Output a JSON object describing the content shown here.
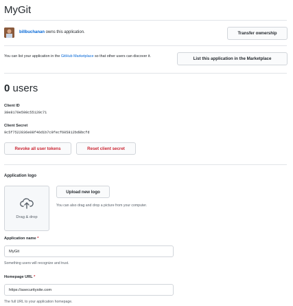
{
  "app": {
    "title": "MyGit"
  },
  "ownership": {
    "owner": "billbuchanan",
    "owns_text": " owns this application.",
    "transfer_label": "Transfer ownership"
  },
  "marketplace": {
    "text_before": "You can list your application in the ",
    "link_text": "GitHub Marketplace",
    "text_after": " so that other users can discover it.",
    "list_label": "List this application in the Marketplace"
  },
  "stats": {
    "user_count": "0",
    "user_word": "users"
  },
  "client": {
    "id_label": "Client ID",
    "id_value": "38e8170e598c55120c71",
    "secret_label": "Client Secret",
    "secret_value": "9c5f7522836e08f46d1b7c9fecf605812bd8bcfd"
  },
  "tokens": {
    "revoke_label": "Revoke all user tokens",
    "reset_label": "Reset client secret"
  },
  "logo": {
    "section_title": "Application logo",
    "drag_drop": "Drag & drop",
    "upload_label": "Upload new logo",
    "help": "You can also drag and drop a picture from your computer."
  },
  "form": {
    "name_label": "Application name",
    "name_value": "MyGit",
    "name_help": "Something users will recognize and trust.",
    "url_label": "Homepage URL",
    "url_value": "https://asecuritysite.com",
    "url_help": "The full URL to your application homepage.",
    "required_mark": "*"
  },
  "colors": {
    "link": "#0366d6",
    "danger": "#cb2431",
    "border": "#d1d5da"
  }
}
